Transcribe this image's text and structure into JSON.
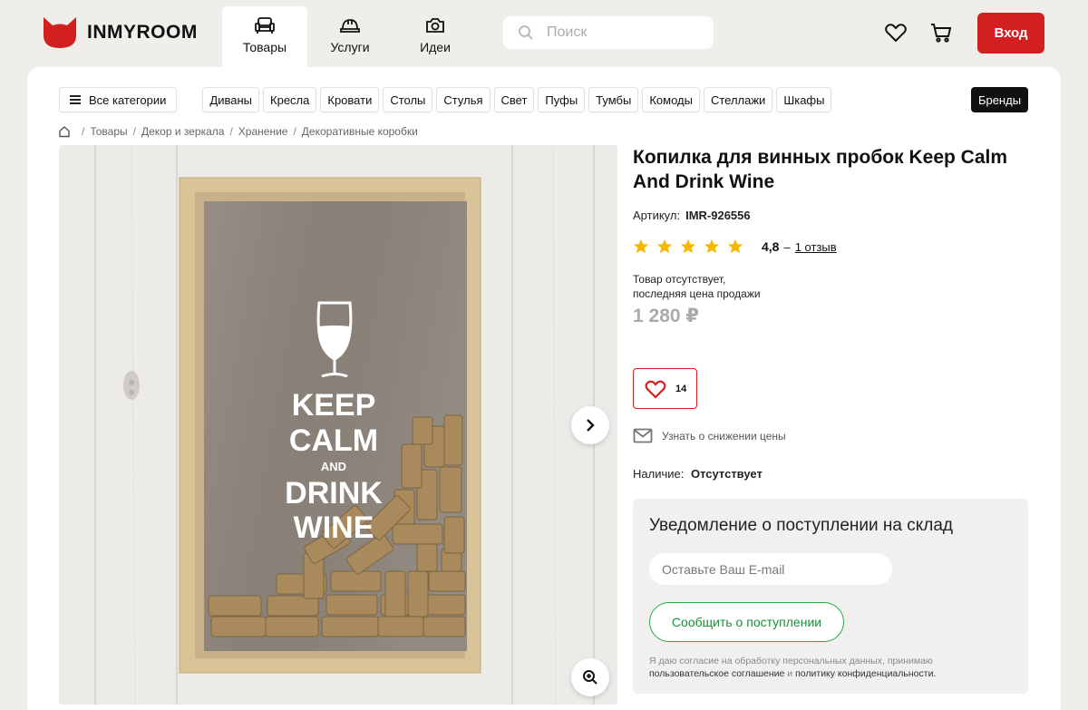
{
  "colors": {
    "brand_red": "#d21f1f",
    "success_green": "#27a943",
    "page_bg": "#f0eeea"
  },
  "header": {
    "logo_text": "INMYROOM",
    "logo_icon": "cat-head-logo",
    "nav": [
      {
        "label": "Товары",
        "icon": "sofa-icon",
        "active": true
      },
      {
        "label": "Услуги",
        "icon": "helmet-icon",
        "active": false
      },
      {
        "label": "Идеи",
        "icon": "camera-icon",
        "active": false
      }
    ],
    "search_placeholder": "Поиск",
    "login_label": "Вход"
  },
  "categories": {
    "all_label": "Все категории",
    "items": [
      "Диваны",
      "Кресла",
      "Кровати",
      "Столы",
      "Стулья",
      "Свет",
      "Пуфы",
      "Тумбы",
      "Комоды",
      "Стеллажи",
      "Шкафы"
    ],
    "brands_label": "Бренды"
  },
  "breadcrumbs": [
    "Товары",
    "Декор и зеркала",
    "Хранение",
    "Декоративные коробки"
  ],
  "product": {
    "title": "Копилка для винных пробок Keep Calm And Drink Wine",
    "sku_label": "Артикул:",
    "sku": "IMR-926556",
    "rating": "4,8",
    "rating_stars": 5,
    "reviews_link": "1 отзыв",
    "stock_note_line1": "Товар отсутствует,",
    "stock_note_line2": "последняя цена продажи",
    "price": "1 280 ₽",
    "favorites_count": "14",
    "price_drop_label": "Узнать о снижении цены",
    "availability_label": "Наличие:",
    "availability_value": "Отсутствует",
    "image_text": [
      "KEEP",
      "CALM",
      "AND",
      "DRINK",
      "WINE"
    ]
  },
  "notify": {
    "title": "Уведомление о поступлении на склад",
    "email_placeholder": "Оставьте Ваш E-mail",
    "button_label": "Сообщить о поступлении",
    "consent_text": "Я даю согласие на обработку персональных данных, принимаю",
    "consent_link1": "пользовательское соглашение",
    "consent_and": "и",
    "consent_link2": "политику конфиденциальности."
  }
}
